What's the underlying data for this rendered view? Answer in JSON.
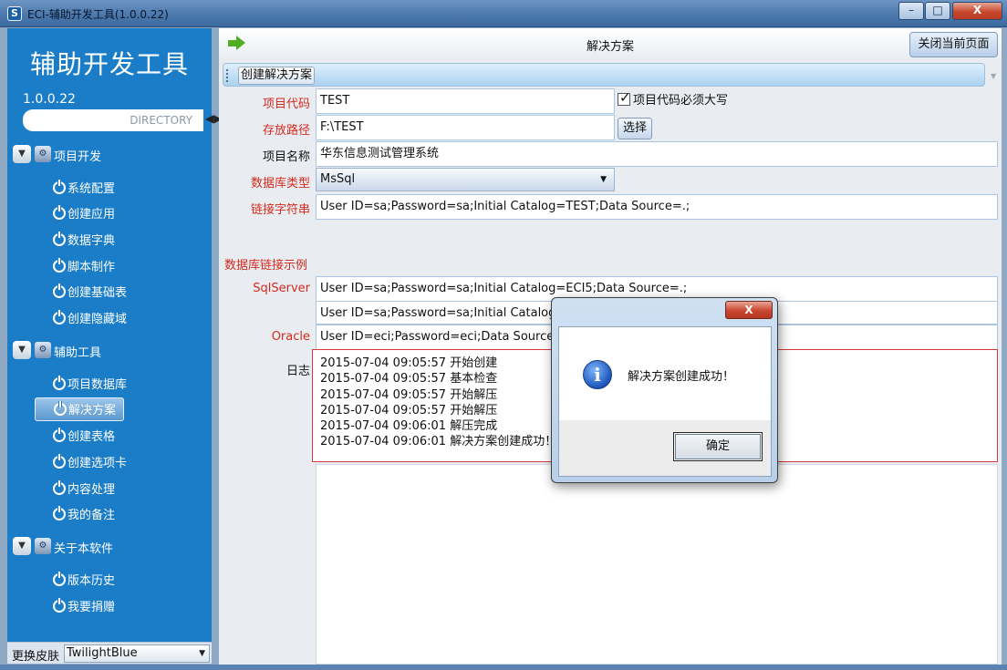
{
  "window": {
    "title": "ECI-辅助开发工具(1.0.0.22)",
    "min": "–",
    "max": "□",
    "close": "X"
  },
  "sidebar": {
    "heading": "辅助开发工具",
    "version": "1.0.0.22",
    "directory": "DIRECTORY",
    "groups": [
      {
        "label": "项目开发",
        "items": [
          "系统配置",
          "创建应用",
          "数据字典",
          "脚本制作",
          "创建基础表",
          "创建隐藏域"
        ]
      },
      {
        "label": "辅助工具",
        "items": [
          "项目数据库",
          "解决方案",
          "创建表格",
          "创建选项卡",
          "内容处理",
          "我的备注"
        ]
      },
      {
        "label": "关于本软件",
        "items": [
          "版本历史",
          "我要捐赠"
        ]
      }
    ],
    "active_item": "解决方案",
    "skin_label": "更换皮肤",
    "skin_value": "TwilightBlue"
  },
  "main": {
    "title": "解决方案",
    "close_page": "关闭当前页面",
    "toolbar_button": "创建解决方案",
    "form": {
      "code_label": "项目代码",
      "code_value": "TEST",
      "upper_label": "项目代码必须大写",
      "upper_checked": true,
      "path_label": "存放路径",
      "path_value": "F:\\TEST",
      "choose": "选择",
      "name_label": "项目名称",
      "name_value": "华东信息测试管理系统",
      "dbtype_label": "数据库类型",
      "dbtype_value": "MsSql",
      "conn_label": "链接字符串",
      "conn_value": "User ID=sa;Password=sa;Initial Catalog=TEST;Data Source=.;"
    },
    "examples": {
      "label": "数据库链接示例",
      "sqlserver_label": "SqlServer",
      "sqlserver_1": "User ID=sa;Password=sa;Initial Catalog=ECI5;Data Source=.;",
      "sqlserver_2": "User ID=sa;Password=sa;Initial Catalog=",
      "oracle_label": "Oracle",
      "oracle": "User ID=eci;Password=eci;Data Source="
    },
    "log_label": "日志",
    "log": [
      "2015-07-04 09:05:57 开始创建",
      "2015-07-04 09:05:57 基本检查",
      "2015-07-04 09:05:57 开始解压",
      "2015-07-04 09:05:57 开始解压",
      "2015-07-04 09:06:01 解压完成",
      "2015-07-04 09:06:01 解决方案创建成功！"
    ]
  },
  "dialog": {
    "close": "X",
    "message": "解决方案创建成功！",
    "ok": "确定"
  }
}
